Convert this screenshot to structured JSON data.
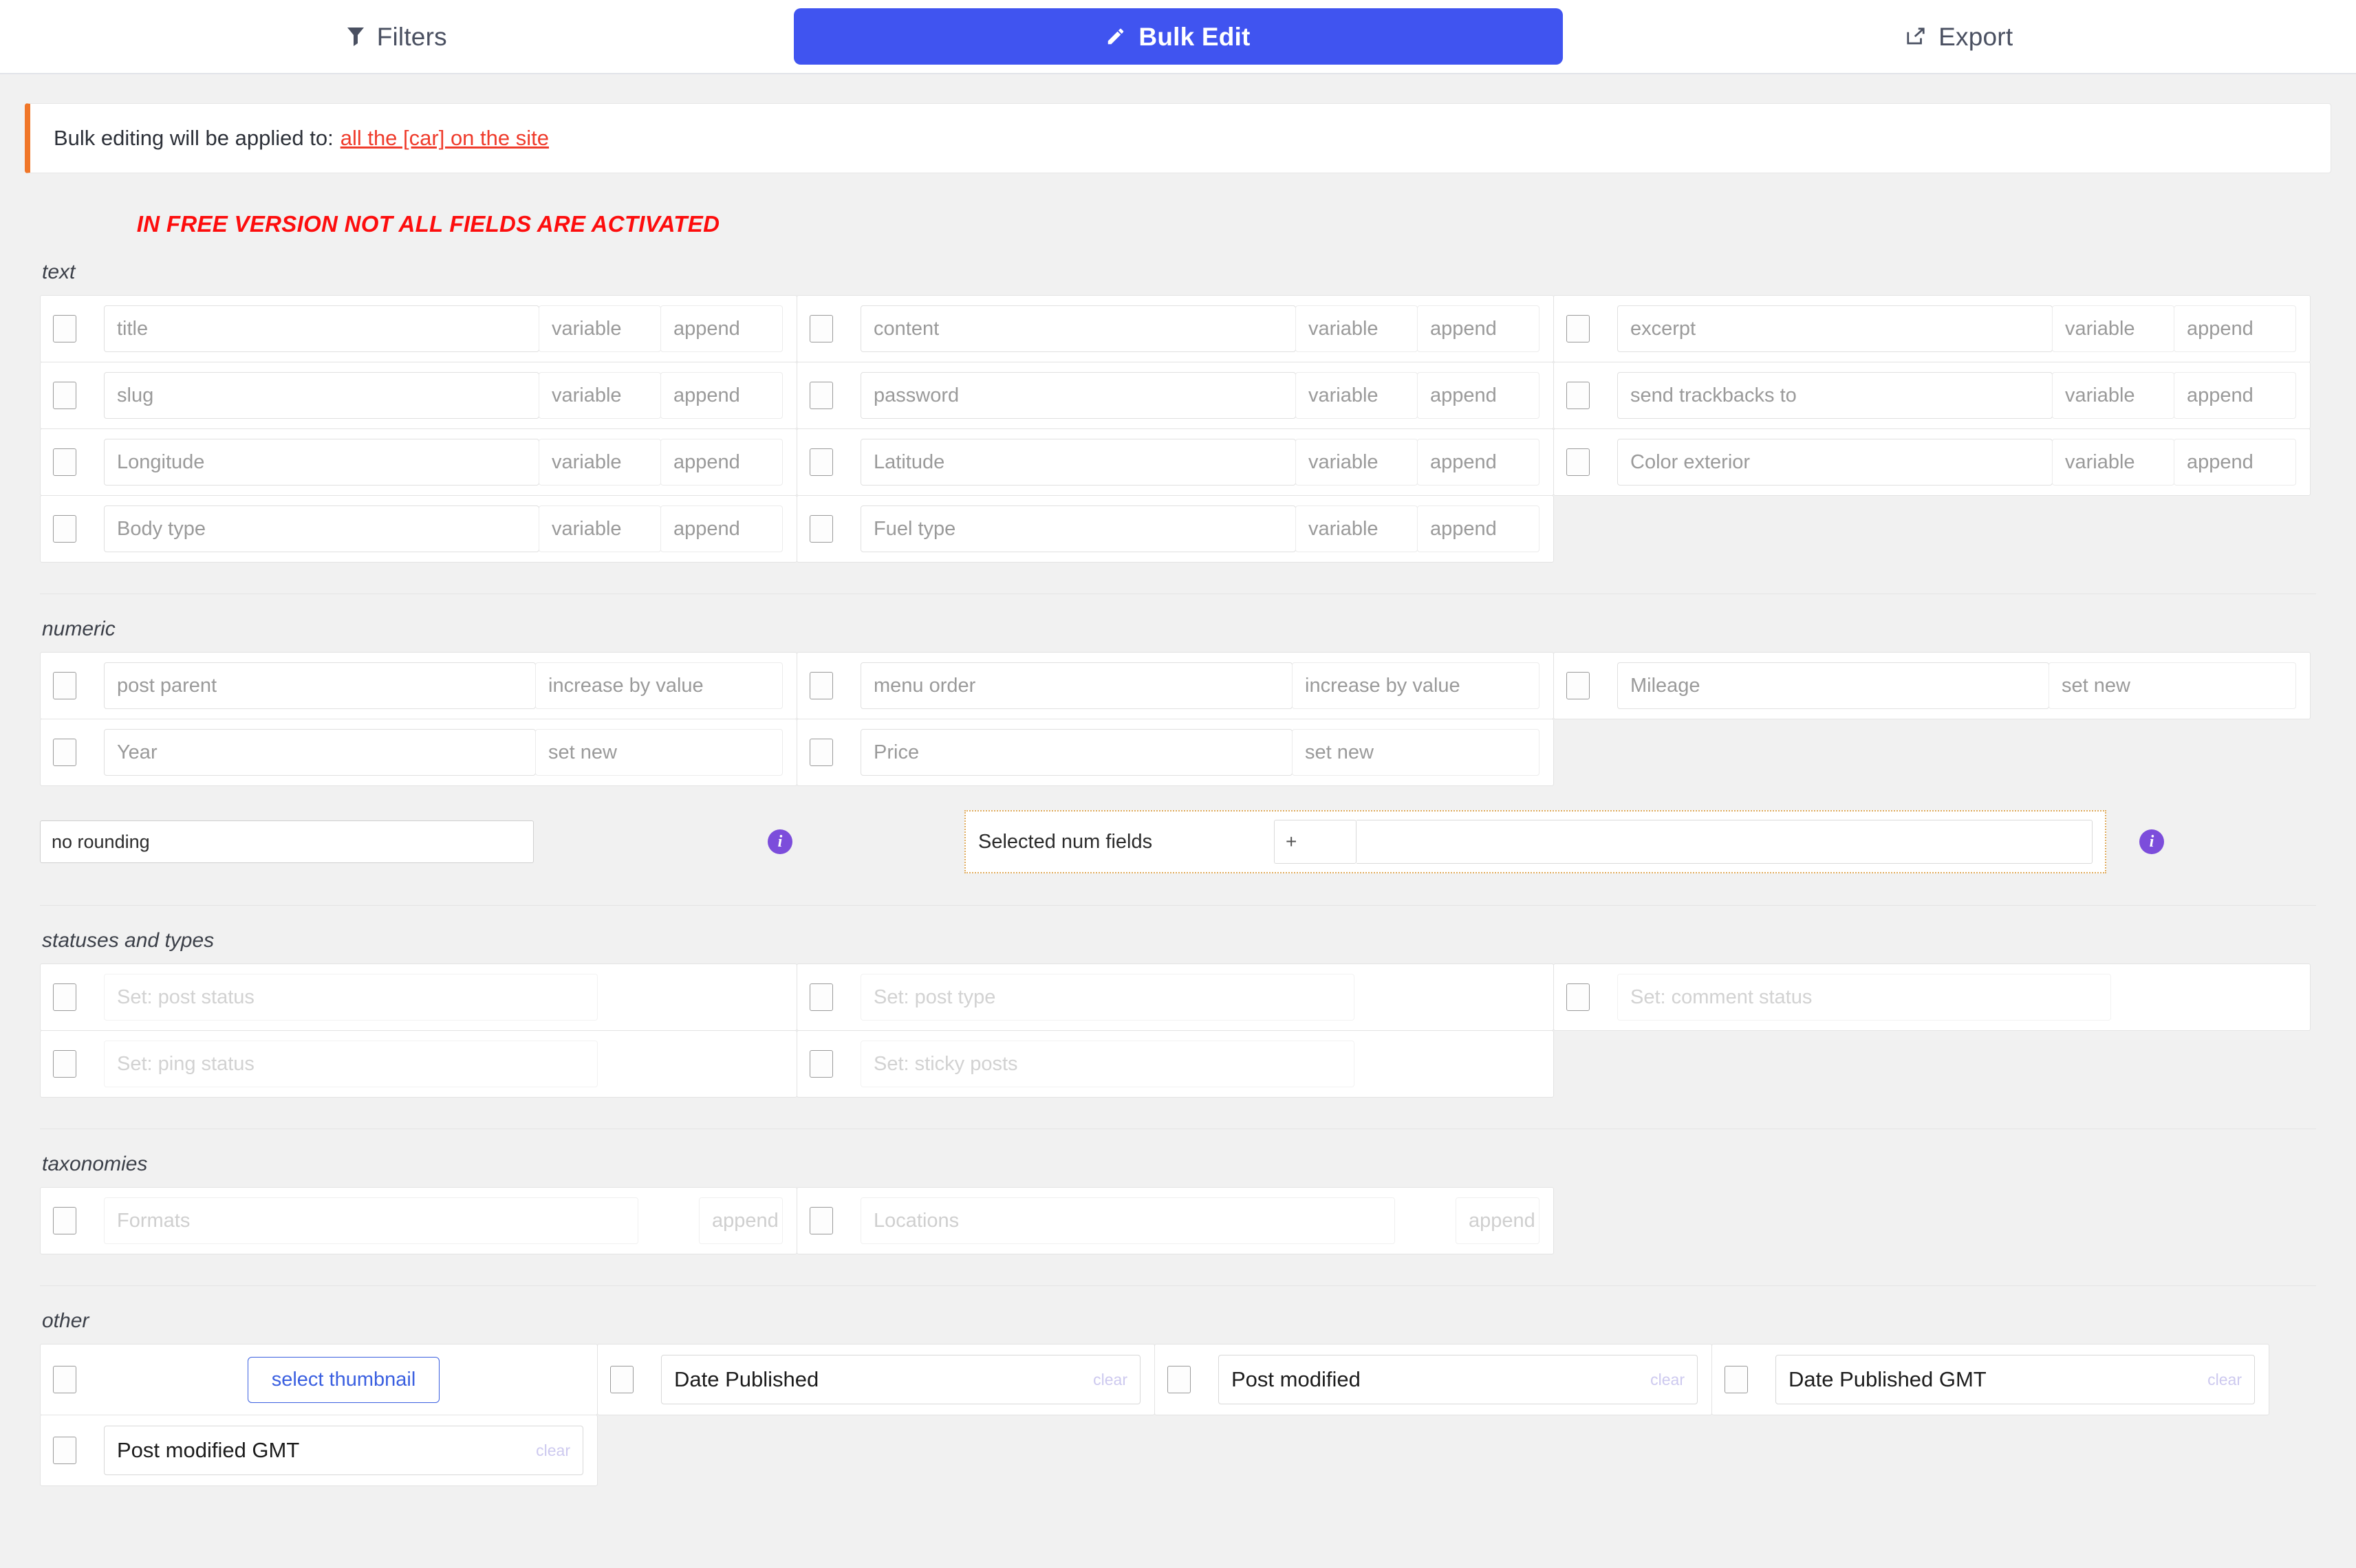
{
  "tabs": [
    {
      "label": "Filters",
      "icon": "filter-icon",
      "active": false
    },
    {
      "label": "Bulk Edit",
      "icon": "pencil-icon",
      "active": true
    },
    {
      "label": "Export",
      "icon": "export-icon",
      "active": false
    }
  ],
  "notice": {
    "text": "Bulk editing will be applied to:",
    "target": "all the [car] on the site"
  },
  "free_banner": "IN FREE VERSION NOT ALL FIELDS ARE ACTIVATED",
  "sections": {
    "text": {
      "title": "text",
      "side_labels": {
        "variable": "variable",
        "append": "append"
      },
      "rows": [
        {
          "placeholder": "title",
          "variable": "variable",
          "append": "append"
        },
        {
          "placeholder": "content",
          "variable": "variable",
          "append": "append"
        },
        {
          "placeholder": "excerpt",
          "variable": "variable",
          "append": "append"
        },
        {
          "placeholder": "slug",
          "variable": "variable",
          "append": "append"
        },
        {
          "placeholder": "password",
          "variable": "variable",
          "append": "append"
        },
        {
          "placeholder": "send trackbacks to",
          "variable": "variable",
          "append": "append"
        },
        {
          "placeholder": "Longitude",
          "variable": "variable",
          "append": "append"
        },
        {
          "placeholder": "Latitude",
          "variable": "variable",
          "append": "append"
        },
        {
          "placeholder": "Color exterior",
          "variable": "variable",
          "append": "append"
        },
        {
          "placeholder": "Body type",
          "variable": "variable",
          "append": "append"
        },
        {
          "placeholder": "Fuel type",
          "variable": "variable",
          "append": "append"
        }
      ]
    },
    "numeric": {
      "title": "numeric",
      "rows": [
        {
          "placeholder": "post parent",
          "action": "increase by value"
        },
        {
          "placeholder": "menu order",
          "action": "increase by value"
        },
        {
          "placeholder": "Mileage",
          "action": "set new"
        },
        {
          "placeholder": "Year",
          "action": "set new"
        },
        {
          "placeholder": "Price",
          "action": "set new"
        }
      ],
      "rounding_value": "no rounding",
      "selected_num_fields_label": "Selected num fields",
      "plus_label": "+",
      "num_fields_value": ""
    },
    "statuses": {
      "title": "statuses and types",
      "rows": [
        {
          "placeholder": "Set: post status"
        },
        {
          "placeholder": "Set: post type"
        },
        {
          "placeholder": "Set: comment status"
        },
        {
          "placeholder": "Set: ping status"
        },
        {
          "placeholder": "Set: sticky posts"
        }
      ]
    },
    "taxonomies": {
      "title": "taxonomies",
      "rows": [
        {
          "placeholder": "Formats",
          "append": "append"
        },
        {
          "placeholder": "Locations",
          "append": "append"
        }
      ]
    },
    "other": {
      "title": "other",
      "thumbnail_button": "select thumbnail",
      "clear_label": "clear",
      "dates": [
        {
          "label": "Date Published"
        },
        {
          "label": "Post modified"
        },
        {
          "label": "Date Published GMT"
        },
        {
          "label": "Post modified GMT"
        }
      ]
    }
  },
  "colors": {
    "accent": "#4054f0",
    "notice_bar": "#f07628",
    "warning_red": "#fd0d0d",
    "link_red": "#ef3b2b",
    "info_purple": "#7c4ddb",
    "thumb_blue": "#3a5fe0",
    "dotted_orange": "#e0ab5c"
  }
}
